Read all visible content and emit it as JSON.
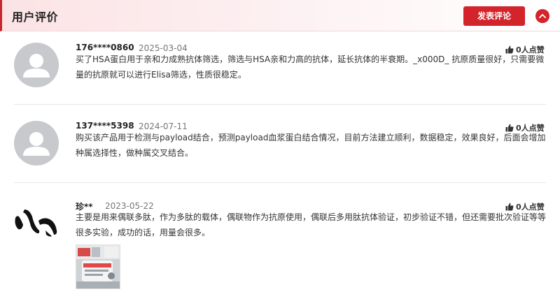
{
  "header": {
    "title": "用户评价",
    "post_button": "发表评论",
    "collapse_icon": "chevron-up-icon",
    "accent_color": "#d3242b"
  },
  "reviews": [
    {
      "user": "176****0860",
      "date": "2025-03-04",
      "likes": "0人点赞",
      "content": "买了HSA蛋白用于亲和力成熟抗体筛选，筛选与HSA亲和力高的抗体，延长抗体的半衰期。_x000D_ 抗原质量很好，只需要微量的抗原就可以进行Elisa筛选，性质很稳定。",
      "avatar": "default-avatar-icon"
    },
    {
      "user": "137****5398",
      "date": "2024-07-11",
      "likes": "0人点赞",
      "content": "购买该产品用于检测与payload结合，预测payload血浆蛋白结合情况，目前方法建立顺利，数据稳定，效果良好，后面会增加种属选择性，做种属交叉结合。",
      "avatar": "default-avatar-icon"
    },
    {
      "user": "珍**",
      "date": "2023-05-22",
      "likes": "0人点赞",
      "content": "主要是用来偶联多肽，作为多肽的载体，偶联物作为抗原使用，偶联后多用肽抗体验证，初步验证不错，但还需要批次验证等等很多实验，成功的话，用量会很多。",
      "avatar": "brush-stroke-avatar",
      "has_photo": true
    }
  ]
}
